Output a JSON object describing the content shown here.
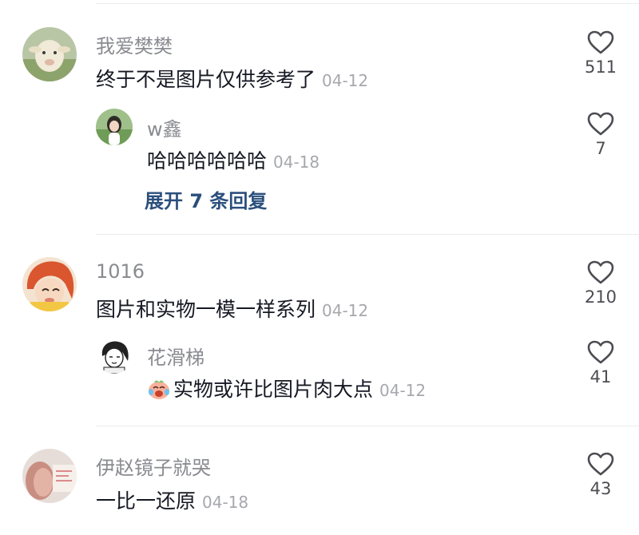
{
  "comments": [
    {
      "username": "我爱樊樊",
      "text": "终于不是图片仅供参考了",
      "date": "04-12",
      "likes": "511",
      "reply": {
        "username": "w鑫",
        "text": "哈哈哈哈哈哈",
        "date": "04-18",
        "likes": "7"
      },
      "expand_label": "展开 7 条回复"
    },
    {
      "username": "1016",
      "text": "图片和实物一模一样系列",
      "date": "04-12",
      "likes": "210",
      "reply": {
        "username": "花滑梯",
        "text": "实物或许比图片肉大点",
        "date": "04-12",
        "likes": "41",
        "emoji": "crying-laughing-emoji"
      }
    },
    {
      "username": "伊赵镜子就哭",
      "text": "一比一还原",
      "date": "04-18",
      "likes": "43"
    }
  ],
  "colors": {
    "username": "#8a8b91",
    "text": "#161823",
    "date": "#a7a8ad",
    "expand": "#2b4f7c",
    "like_count": "#4c4d52"
  },
  "icons": [
    "heart-outline-icon"
  ]
}
